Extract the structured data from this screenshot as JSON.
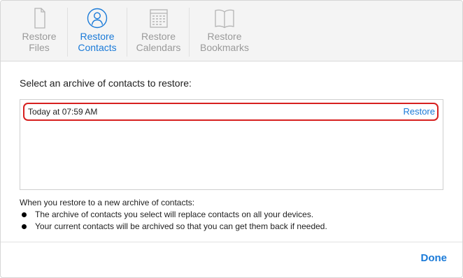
{
  "toolbar": {
    "tabs": [
      {
        "label": "Restore\nFiles",
        "icon": "document-icon",
        "active": false
      },
      {
        "label": "Restore\nContacts",
        "icon": "contacts-icon",
        "active": true
      },
      {
        "label": "Restore\nCalendars",
        "icon": "calendar-icon",
        "active": false
      },
      {
        "label": "Restore\nBookmarks",
        "icon": "book-icon",
        "active": false
      }
    ]
  },
  "main": {
    "heading": "Select an archive of contacts to restore:",
    "archives": [
      {
        "date": "Today at 07:59 AM",
        "action": "Restore"
      }
    ],
    "note_title": "When you restore to a new archive of contacts:",
    "notes": [
      "The archive of contacts you select will replace contacts on all your devices.",
      "Your current contacts will be archived so that you can get them back if needed."
    ]
  },
  "footer": {
    "done_label": "Done"
  },
  "colors": {
    "accent": "#1a7ad8",
    "highlight": "#d7201f",
    "inactive": "#9a9a9a"
  }
}
